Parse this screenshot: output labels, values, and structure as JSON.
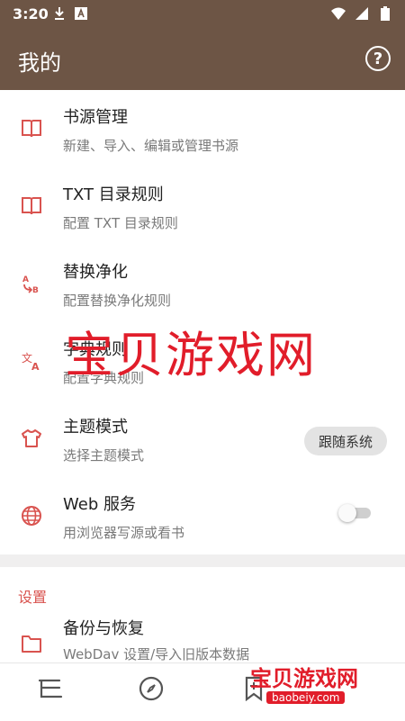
{
  "status_bar": {
    "time": "3:20"
  },
  "app_bar": {
    "title": "我的"
  },
  "items": [
    {
      "title": "书源管理",
      "subtitle": "新建、导入、编辑或管理书源",
      "icon": "book-icon"
    },
    {
      "title": "TXT 目录规则",
      "subtitle": "配置 TXT 目录规则",
      "icon": "book-icon"
    },
    {
      "title": "替换净化",
      "subtitle": "配置替换净化规则",
      "icon": "replace-icon"
    },
    {
      "title": "字典规则",
      "subtitle": "配置字典规则",
      "icon": "translate-icon"
    },
    {
      "title": "主题模式",
      "subtitle": "选择主题模式",
      "icon": "shirt-icon",
      "pill": "跟随系统"
    },
    {
      "title": "Web 服务",
      "subtitle": "用浏览器写源或看书",
      "icon": "globe-icon",
      "toggle": "off"
    }
  ],
  "settings_section": {
    "header": "设置"
  },
  "settings_items": [
    {
      "title": "备份与恢复",
      "subtitle": "WebDav 设置/导入旧版本数据",
      "icon": "folder-icon"
    }
  ],
  "watermark": "宝贝游戏网",
  "logo": {
    "text": "宝贝游戏网",
    "sub": "baobeiy.com"
  },
  "colors": {
    "primary": "#6d5545",
    "accent": "#d9534f"
  }
}
